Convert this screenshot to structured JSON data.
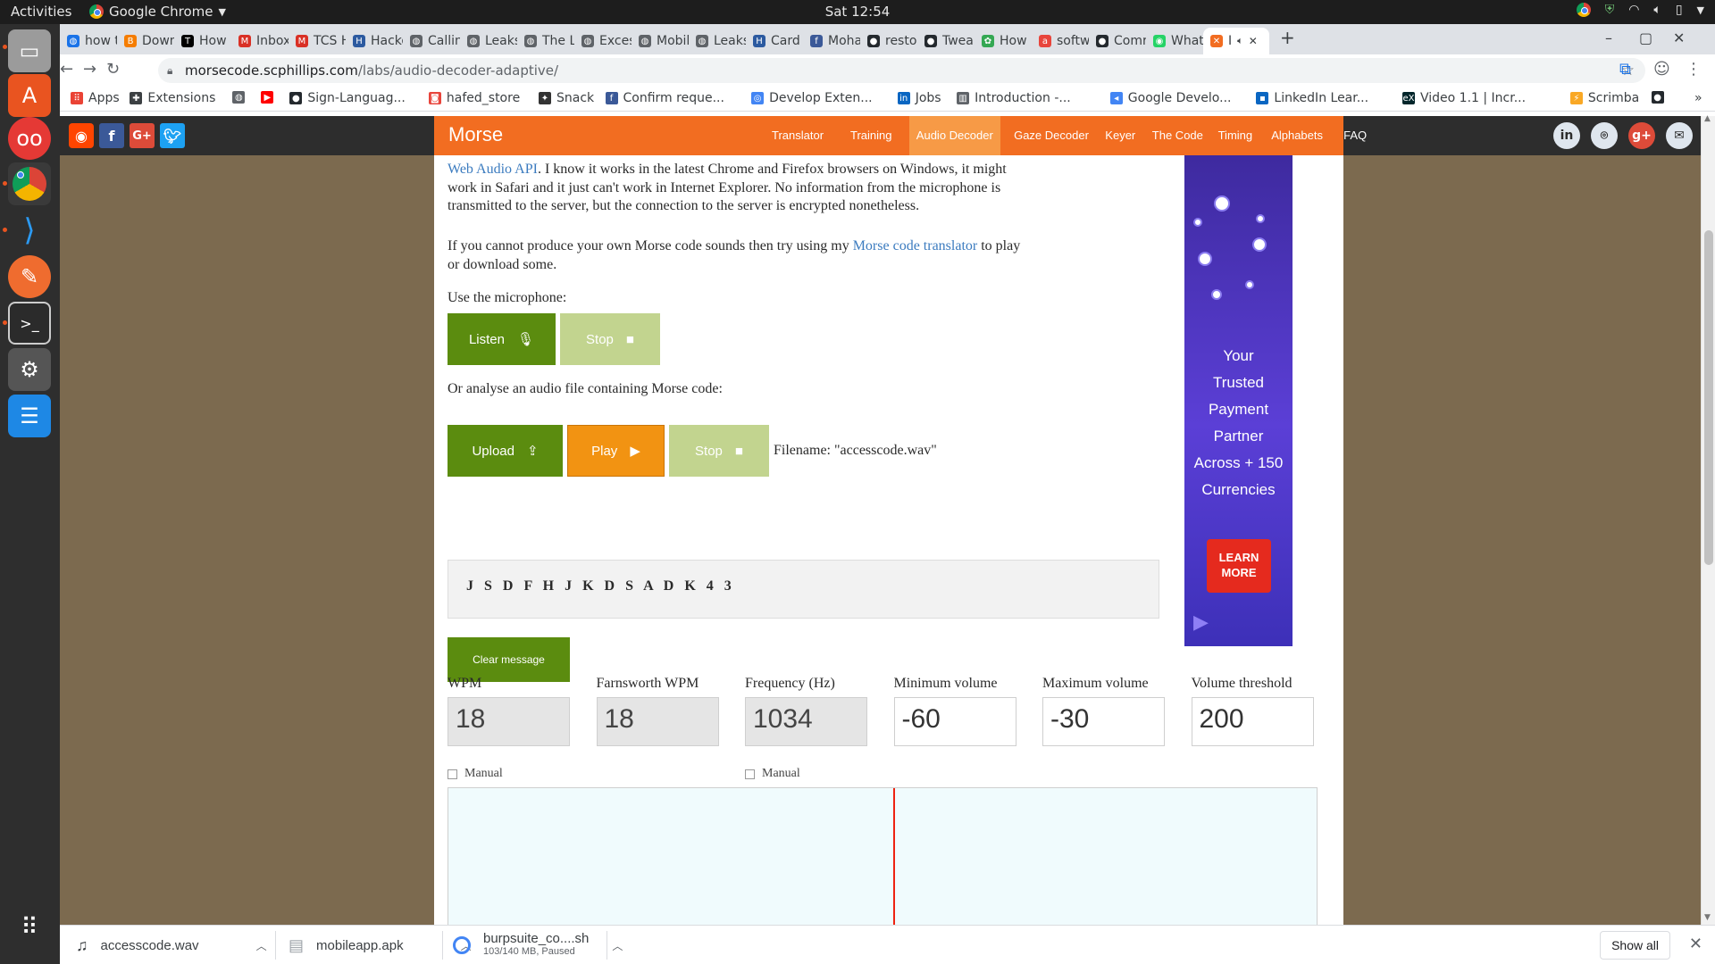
{
  "topbar": {
    "activities": "Activities",
    "app_name": "Google Chrome",
    "clock": "Sat 12:54"
  },
  "tabs": [
    {
      "label": "how t",
      "icon": "globe-icon",
      "color": "#1a73e8"
    },
    {
      "label": "Down",
      "icon": "blogger-icon",
      "color": "#f57d00"
    },
    {
      "label": "How",
      "icon": "t0-icon",
      "color": "#000000"
    },
    {
      "label": "Inbox",
      "icon": "gmail-icon",
      "color": "#d93025"
    },
    {
      "label": "TCS H",
      "icon": "gmail-icon",
      "color": "#d93025"
    },
    {
      "label": "Hacko",
      "icon": "hackerrank-icon",
      "color": "#2c5aa0"
    },
    {
      "label": "Callin",
      "icon": "globe-icon",
      "color": "#5f6368"
    },
    {
      "label": "Leaks",
      "icon": "globe-icon",
      "color": "#5f6368"
    },
    {
      "label": "The L",
      "icon": "globe-icon",
      "color": "#5f6368"
    },
    {
      "label": "Exces",
      "icon": "globe-icon",
      "color": "#5f6368"
    },
    {
      "label": "Mobil",
      "icon": "globe-icon",
      "color": "#5f6368"
    },
    {
      "label": "Leaks",
      "icon": "globe-icon",
      "color": "#5f6368"
    },
    {
      "label": "Card",
      "icon": "hackerrank-icon",
      "color": "#2c5aa0"
    },
    {
      "label": "Moha",
      "icon": "facebook-icon",
      "color": "#3b5998"
    },
    {
      "label": "resto",
      "icon": "github-icon",
      "color": "#24292e"
    },
    {
      "label": "Twea",
      "icon": "github-icon",
      "color": "#24292e"
    },
    {
      "label": "How",
      "icon": "gear-icon",
      "color": "#34a853"
    },
    {
      "label": "softw",
      "icon": "ask-icon",
      "color": "#e8453c"
    },
    {
      "label": "Comr",
      "icon": "github-icon",
      "color": "#24292e"
    },
    {
      "label": "What",
      "icon": "whatsapp-icon",
      "color": "#25d366"
    },
    {
      "label": "I",
      "icon": "morse-icon",
      "color": "#f26d21",
      "active": true
    }
  ],
  "omnibox": {
    "host": "morsecode.scphillips.com",
    "path": "/labs/audio-decoder-adaptive/"
  },
  "bookmarks": [
    {
      "label": "Apps",
      "icon": "apps-grid-icon",
      "color": "#ea4335"
    },
    {
      "label": "Extensions",
      "icon": "puzzle-icon",
      "color": "#3c4043"
    },
    {
      "label": "",
      "icon": "globe-icon",
      "color": "#5f6368"
    },
    {
      "label": "",
      "icon": "youtube-icon",
      "color": "#ff0000"
    },
    {
      "label": "Sign-Languag...",
      "icon": "github-icon",
      "color": "#24292e"
    },
    {
      "label": "hafed_store",
      "icon": "store-icon",
      "color": "#e8453c"
    },
    {
      "label": "Snack",
      "icon": "snack-icon",
      "color": "#333333"
    },
    {
      "label": "Confirm reque...",
      "icon": "facebook-icon",
      "color": "#3b5998"
    },
    {
      "label": "Develop Exten...",
      "icon": "chrome-icon",
      "color": "#4285f4"
    },
    {
      "label": "Jobs",
      "icon": "linkedin-icon",
      "color": "#0a66c2"
    },
    {
      "label": "Introduction -...",
      "icon": "book-icon",
      "color": "#5f6368"
    },
    {
      "label": "Google Develo...",
      "icon": "google-dev-icon",
      "color": "#4285f4"
    },
    {
      "label": "LinkedIn Lear...",
      "icon": "linkedin-learning-icon",
      "color": "#0a66c2"
    },
    {
      "label": "Video 1.1 | Incr...",
      "icon": "edx-icon",
      "color": "#02262b"
    },
    {
      "label": "Scrimba",
      "icon": "scrimba-icon",
      "color": "#f9a825"
    },
    {
      "label": "",
      "icon": "github-icon",
      "color": "#24292e"
    }
  ],
  "site": {
    "brand": "Morse",
    "nav": [
      "Translator",
      "Training",
      "Audio Decoder",
      "Gaze Decoder",
      "Keyer",
      "The Code",
      "Timing",
      "Alphabets",
      "FAQ"
    ],
    "active_nav": "Audio Decoder",
    "accent": "#f26d21"
  },
  "content": {
    "intro_line2_a": "Web Audio API",
    "intro_line2_b": ". I know it works in the latest Chrome and Firefox browsers on Windows, it might work in Safari and it just can't work in Internet Explorer. No information from the microphone is transmitted to the server, but the connection to the server is encrypted nonetheless.",
    "translator_p_a": "If you cannot produce your own Morse code sounds then try using my ",
    "translator_link": "Morse code translator",
    "translator_p_b": " to play or download some.",
    "use_mic": "Use the microphone:",
    "listen": "Listen",
    "stop": "Stop",
    "or_analyse": "Or analyse an audio file containing Morse code:",
    "upload": "Upload",
    "play": "Play",
    "filename": "Filename: \"accesscode.wav\"",
    "decoded": "J S D F H J K D S A D K 4 3",
    "clear": "Clear message",
    "fields": [
      {
        "label": "WPM",
        "value": "18",
        "disabled": true
      },
      {
        "label": "Farnsworth WPM",
        "value": "18",
        "disabled": true
      },
      {
        "label": "Frequency (Hz)",
        "value": "1034",
        "disabled": true
      },
      {
        "label": "Minimum volume",
        "value": "-60",
        "disabled": false
      },
      {
        "label": "Maximum volume",
        "value": "-30",
        "disabled": false
      },
      {
        "label": "Volume threshold",
        "value": "200",
        "disabled": false
      }
    ],
    "manual": "Manual"
  },
  "ad": {
    "lines": [
      "Your",
      "Trusted",
      "Payment",
      "Partner",
      "Across + 150",
      "Currencies"
    ],
    "cta_line1": "LEARN",
    "cta_line2": "MORE"
  },
  "downloads": [
    {
      "name": "accesscode.wav",
      "status": "",
      "icon": "music-note-icon"
    },
    {
      "name": "mobileapp.apk",
      "status": "",
      "icon": "file-icon"
    },
    {
      "name": "burpsuite_co....sh",
      "status": "103/140 MB, Paused",
      "icon": "download-progress-icon"
    }
  ],
  "show_all": "Show all"
}
